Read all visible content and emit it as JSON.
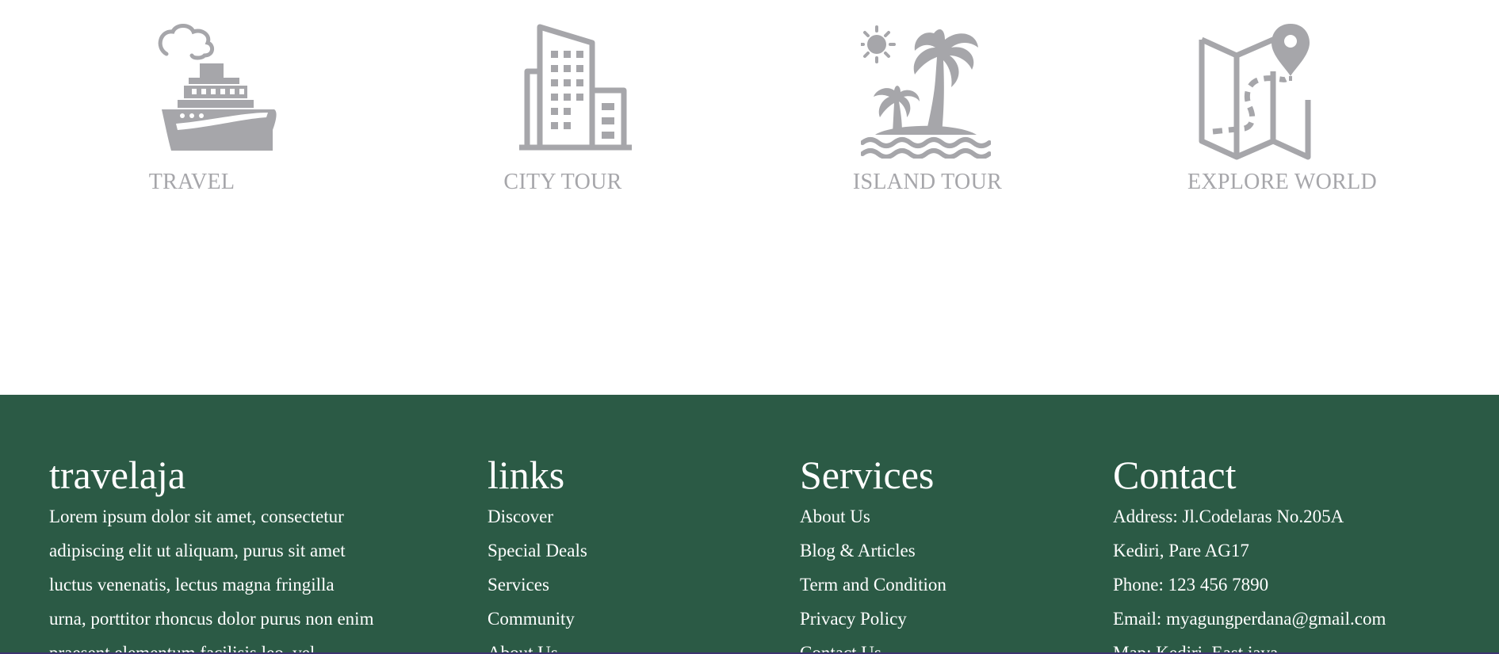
{
  "features": [
    {
      "id": "travel",
      "label": "TRAVEL",
      "icon": "cruise-ship-icon"
    },
    {
      "id": "city",
      "label": "CITY TOUR",
      "icon": "city-buildings-icon"
    },
    {
      "id": "island",
      "label": "ISLAND TOUR",
      "icon": "palm-island-icon"
    },
    {
      "id": "explore",
      "label": "EXPLORE WORLD",
      "icon": "folded-map-pin-icon"
    }
  ],
  "footer": {
    "brand": {
      "title": "travelaja",
      "lines": [
        "Lorem ipsum dolor sit amet, consectetur",
        "adipiscing elit ut aliquam, purus sit amet",
        "luctus venenatis, lectus magna fringilla",
        "urna, porttitor rhoncus dolor purus non enim",
        "praesent elementum facilisis leo, vel"
      ]
    },
    "links": {
      "title": "links",
      "items": [
        "Discover",
        "Special Deals",
        "Services",
        "Community",
        "About Us"
      ]
    },
    "services": {
      "title": "Services",
      "items": [
        "About Us",
        "Blog & Articles",
        "Term and Condition",
        "Privacy Policy",
        "Contact Us"
      ]
    },
    "contact": {
      "title": "Contact",
      "lines": [
        "Address: Jl.Codelaras No.205A",
        "Kediri, Pare AG17",
        "Phone: 123 456 7890",
        "Email: myagungperdana@gmail.com",
        "Map: Kediri, East java"
      ]
    }
  },
  "colors": {
    "icon_gray": "#a6a6aa",
    "footer_bg": "#2b5a45",
    "footer_text": "#ffffff"
  }
}
